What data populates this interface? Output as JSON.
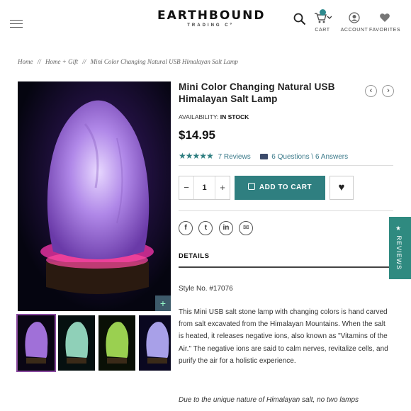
{
  "header": {
    "logo_main": "EARTHBOUND",
    "logo_sub": "TRADING Cº",
    "cart_label": "CART",
    "account_label": "ACCOUNT",
    "favorites_label": "FAVORITES",
    "accent": "#2f7f80"
  },
  "breadcrumb": {
    "items": [
      "Home",
      "Home + Gift",
      "Mini Color Changing Natural USB Himalayan Salt Lamp"
    ],
    "separator": "//"
  },
  "product": {
    "title": "Mini Color Changing Natural USB Himalayan Salt Lamp",
    "availability_label": "AVAILABILITY:",
    "availability_value": "IN STOCK",
    "price": "$14.95",
    "rating": 4.5,
    "reviews_text": "7 Reviews",
    "questions_text": "6 Questions \\ 6 Answers",
    "quantity": "1",
    "qty_minus": "−",
    "qty_plus": "+",
    "add_to_cart": "ADD TO CART",
    "share_icons": [
      "facebook-icon",
      "twitter-icon",
      "linkedin-icon",
      "email-icon"
    ],
    "details_tab": "DETAILS",
    "style_no": "Style No. #17076",
    "description": "This Mini USB salt stone lamp with changing colors is hand carved from salt excavated from the Himalayan Mountains. When the salt is heated, it releases negative ions, also known as \"Vitamins of the Air.\" The negative ions are said to calm nerves, revitalize cells, and purify the air for a holistic experience.",
    "note": "Due to the unique nature of Himalayan salt, no two lamps"
  },
  "gallery": {
    "main_color": "#a070d8",
    "thumb_colors": [
      "#a070d8",
      "#8fd0b8",
      "#9ad050",
      "#a8a0e8"
    ]
  },
  "reviews_tab": "★ REVIEWS",
  "icons": {
    "prev": "‹",
    "next": "›",
    "zoom": "+",
    "heart": "♥",
    "stars": "★★★★★"
  }
}
